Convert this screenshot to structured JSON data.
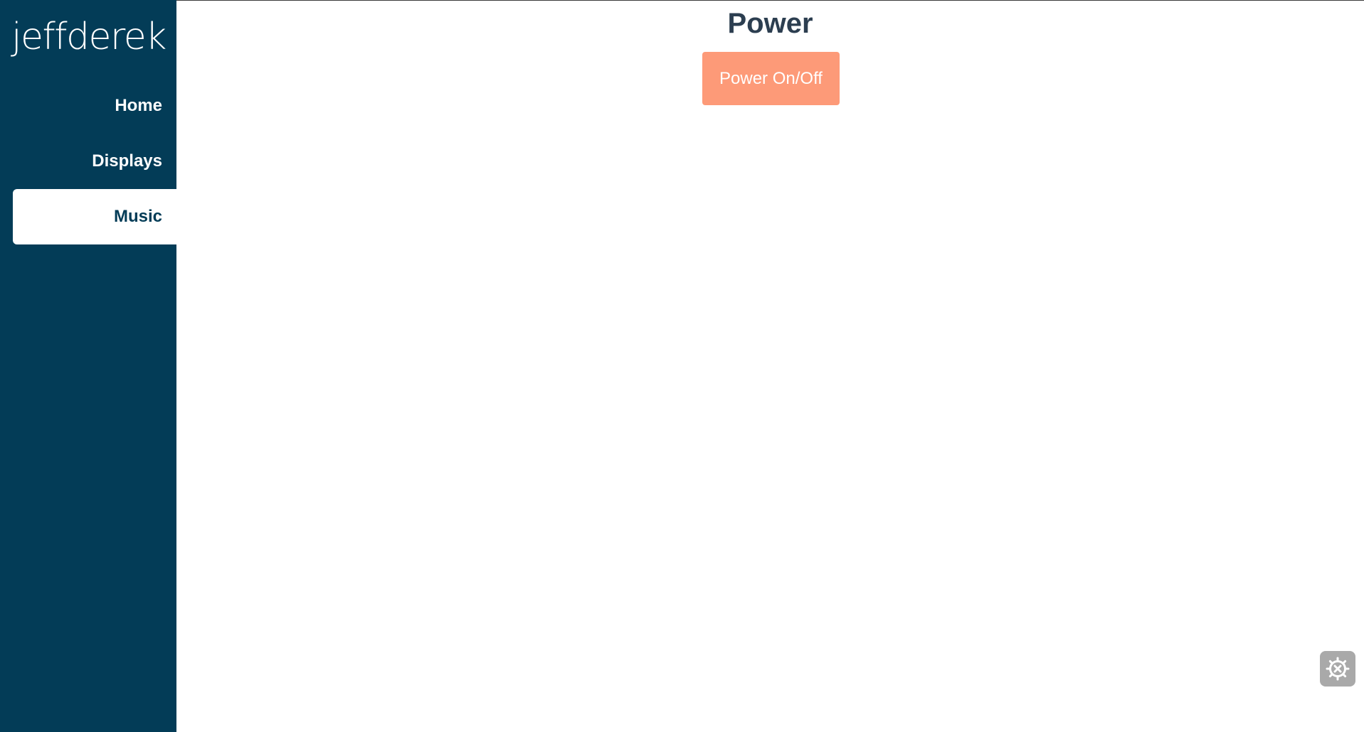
{
  "sidebar": {
    "logo": "jeffderek",
    "items": [
      {
        "label": "Home",
        "active": false
      },
      {
        "label": "Displays",
        "active": false
      },
      {
        "label": "Music",
        "active": true
      }
    ]
  },
  "main": {
    "title": "Power",
    "power_button_label": "Power On/Off"
  },
  "settings": {
    "icon": "gear-close-icon"
  },
  "colors": {
    "sidebar_bg": "#033c57",
    "accent_button": "#fd9a78",
    "title_text": "#2c3e50",
    "settings_bg": "#a9a9a9"
  }
}
